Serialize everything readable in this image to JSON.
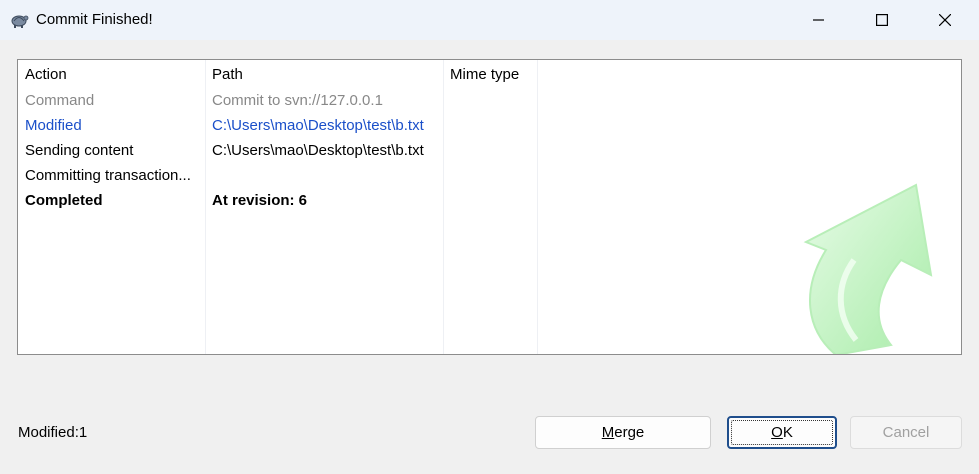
{
  "window": {
    "title": "Commit Finished!",
    "icon": "tortoise-icon"
  },
  "list": {
    "columns": [
      "Action",
      "Path",
      "Mime type"
    ],
    "rows": [
      {
        "action": "Command",
        "path": "Commit to svn://127.0.0.1",
        "style": "gray"
      },
      {
        "action": "Modified",
        "path": "C:\\Users\\mao\\Desktop\\test\\b.txt",
        "style": "blue"
      },
      {
        "action": "Sending content",
        "path": "C:\\Users\\mao\\Desktop\\test\\b.txt",
        "style": "normal"
      },
      {
        "action": "Committing transaction...",
        "path": "",
        "style": "normal"
      },
      {
        "action": "Completed",
        "path": "At revision: 6",
        "style": "bold"
      }
    ]
  },
  "status": {
    "text": "Modified:1"
  },
  "buttons": {
    "merge": {
      "prefix": "",
      "accel": "M",
      "rest": "erge"
    },
    "ok": {
      "prefix": "",
      "accel": "O",
      "rest": "K"
    },
    "cancel": "Cancel"
  },
  "colors": {
    "link_blue": "#1a4fc9",
    "muted_gray": "#888888",
    "arrow_green": "#c8f5c8"
  }
}
